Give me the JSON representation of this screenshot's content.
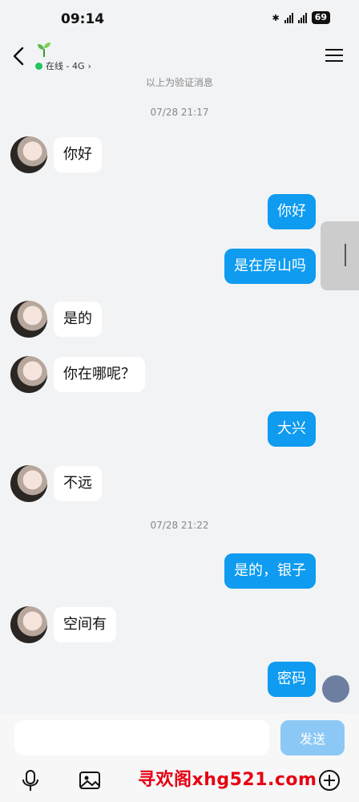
{
  "status": {
    "time": "09:14",
    "battery": "69"
  },
  "header": {
    "status_text": "在线 - 4G",
    "online_color": "#22c55e"
  },
  "chat": {
    "notice": "以上为验证消息",
    "timestamps": [
      "07/28 21:17",
      "07/28 21:22"
    ],
    "messages": [
      {
        "side": "in",
        "text": "你好"
      },
      {
        "side": "out",
        "text": "你好"
      },
      {
        "side": "out",
        "text": "是在房山吗"
      },
      {
        "side": "in",
        "text": "是的"
      },
      {
        "side": "in",
        "text": "你在哪呢？"
      },
      {
        "side": "out",
        "text": "大兴"
      },
      {
        "side": "in",
        "text": "不远"
      },
      {
        "side": "out",
        "text": "是的，银子"
      },
      {
        "side": "in",
        "text": "空间有"
      },
      {
        "side": "out",
        "text": "密码"
      }
    ]
  },
  "input": {
    "value": "",
    "send_label": "发送"
  },
  "watermark": "寻欢阁xhg521.com",
  "colors": {
    "outgoing_bubble": "#0e9bf0",
    "send_button": "#8cc8f5",
    "background": "#f2f3f5"
  }
}
